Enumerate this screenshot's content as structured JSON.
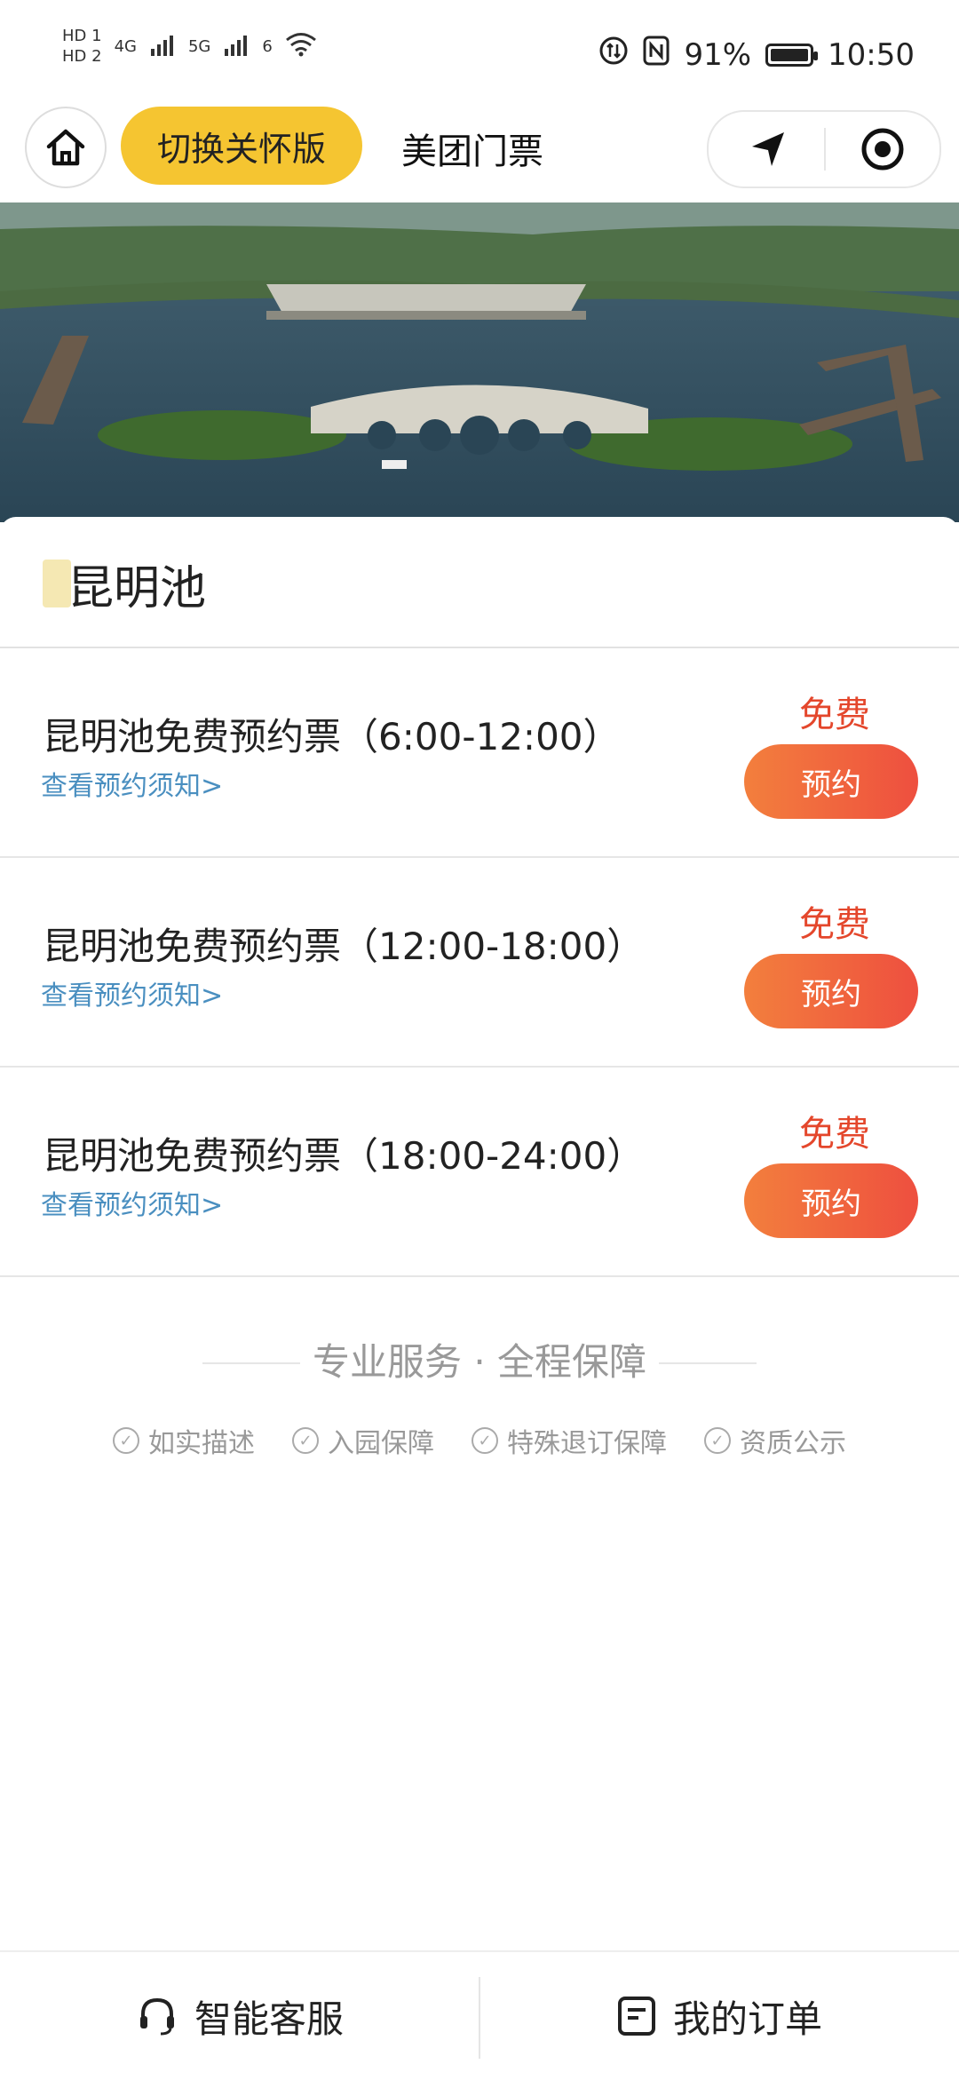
{
  "status_bar": {
    "sim1": "HD 1",
    "sim2": "HD 2",
    "network1": "4G",
    "network2": "5G",
    "wifi_badge": "6",
    "battery": "91%",
    "time": "10:50"
  },
  "header": {
    "care_mode_label": "切换关怀版",
    "title": "美团门票"
  },
  "spot": {
    "name": "昆明池"
  },
  "tickets": [
    {
      "name": "昆明池免费预约票（6:00-12:00）",
      "notice": "查看预约须知>",
      "price": "免费",
      "book_label": "预约"
    },
    {
      "name": "昆明池免费预约票（12:00-18:00）",
      "notice": "查看预约须知>",
      "price": "免费",
      "book_label": "预约"
    },
    {
      "name": "昆明池免费预约票（18:00-24:00）",
      "notice": "查看预约须知>",
      "price": "免费",
      "book_label": "预约"
    }
  ],
  "guarantee": {
    "title": "专业服务 · 全程保障",
    "items": [
      "如实描述",
      "入园保障",
      "特殊退订保障",
      "资质公示"
    ]
  },
  "bottom_bar": {
    "service_label": "智能客服",
    "orders_label": "我的订单"
  },
  "colors": {
    "accent_yellow": "#f5c531",
    "price_red": "#e4472c",
    "link_blue": "#4a8fc0",
    "button_gradient_start": "#f37f3d",
    "button_gradient_end": "#ee4f3f"
  },
  "icons": {
    "home": "home-icon",
    "location": "location-arrow-icon",
    "record": "record-icon",
    "headset": "headset-icon",
    "order": "order-icon",
    "check": "check-circle-icon"
  }
}
